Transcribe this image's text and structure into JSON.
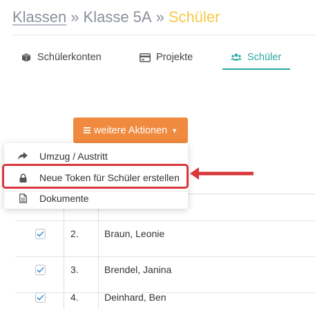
{
  "breadcrumb": {
    "items": [
      {
        "label": "Klassen",
        "link": true
      },
      {
        "label": "Klasse 5A",
        "link": false
      },
      {
        "label": "Schüler",
        "current": true
      }
    ],
    "separator": "»"
  },
  "tabs": [
    {
      "label": "Schülerkonten",
      "icon": "cube-icon",
      "active": false
    },
    {
      "label": "Projekte",
      "icon": "credit-card-icon",
      "active": true,
      "active_note": false
    },
    {
      "label": "Schüler",
      "icon": "users-icon",
      "active": true
    }
  ],
  "actions_button": {
    "label": "weitere Aktionen",
    "icon": "bars-icon"
  },
  "dropdown": {
    "items": [
      {
        "label": "Umzug / Austritt",
        "icon": "share-arrow-icon"
      },
      {
        "label": "Neue Token für Schüler erstellen",
        "icon": "lock-icon",
        "highlighted": true
      },
      {
        "label": "Dokumente",
        "icon": "document-icon"
      }
    ]
  },
  "students": [
    {
      "num": "2.",
      "name": "Braun, Leonie",
      "checked": true
    },
    {
      "num": "3.",
      "name": "Brendel, Janina",
      "checked": true
    },
    {
      "num": "4.",
      "name": "Deinhard, Ben",
      "checked": true
    }
  ],
  "colors": {
    "accent": "#2aa6a0",
    "current_crumb": "#f7c948",
    "button": "#f08a3e",
    "highlight": "#d9353b",
    "checkbox_tick": "#3a8fd6"
  }
}
